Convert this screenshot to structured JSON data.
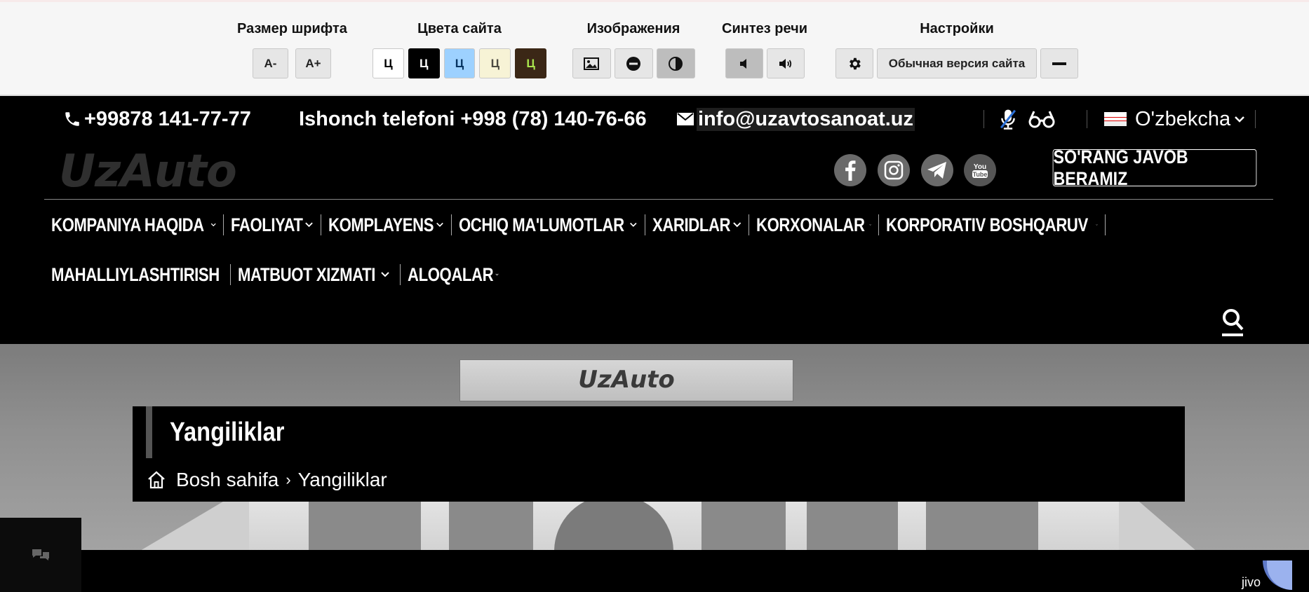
{
  "a11y_panel": {
    "font_size": {
      "title": "Размер шрифта",
      "decrease": "A-",
      "increase": "A+"
    },
    "site_colors": {
      "title": "Цвета сайта",
      "letter": "Ц",
      "swatches": [
        {
          "bg": "#ffffff",
          "fg": "#000000"
        },
        {
          "bg": "#000000",
          "fg": "#ffffff"
        },
        {
          "bg": "#9dd1ff",
          "fg": "#063462"
        },
        {
          "bg": "#f7f3d6",
          "fg": "#4d4b43"
        },
        {
          "bg": "#3b2716",
          "fg": "#a9e44d"
        }
      ]
    },
    "images": {
      "title": "Изображения",
      "icons": [
        "image-icon",
        "images-off-icon",
        "grayscale-icon"
      ]
    },
    "speech": {
      "title": "Синтез речи",
      "icons": [
        "speaker-off-icon",
        "speaker-on-icon"
      ]
    },
    "settings": {
      "title": "Настройки",
      "normal_version": "Обычная версия сайта",
      "icons": [
        "gear-icon",
        "minimize-icon"
      ]
    }
  },
  "contact": {
    "phone": "+99878 141-77-77",
    "trust_phone": "Ishonch telefoni +998 (78) 140-76-66",
    "email": "info@uzavtosanoat.uz",
    "language": "O'zbekcha",
    "icons": [
      "phone-icon",
      "mail-icon",
      "mic-off-icon",
      "glasses-icon",
      "flag-icon",
      "chevron-down-icon"
    ]
  },
  "header": {
    "logo": "UzAuto",
    "social": [
      "facebook-icon",
      "instagram-icon",
      "telegram-icon",
      "youtube-icon"
    ],
    "ask_button": "SO'RANG JAVOB BERAMIZ"
  },
  "nav": {
    "row1": [
      {
        "label": "KOMPANIYA HAQIDA",
        "dropdown": true
      },
      {
        "label": "FAOLIYAT",
        "dropdown": true
      },
      {
        "label": "KOMPLAYENS",
        "dropdown": true
      },
      {
        "label": "OCHIQ MA'LUMOTLAR",
        "dropdown": true
      },
      {
        "label": "XARIDLAR",
        "dropdown": true
      },
      {
        "label": "KORXONALAR",
        "dropdown": true
      },
      {
        "label": "KORPORATIV BOSHQARUV",
        "dropdown": true
      }
    ],
    "row2": [
      {
        "label": "MAHALLIYLASHTIRISH",
        "dropdown": false
      },
      {
        "label": "MATBUOT XIZMATI",
        "dropdown": true
      },
      {
        "label": "ALOQALAR",
        "dropdown": true
      }
    ]
  },
  "hero": {
    "building_logo": "UzAuto",
    "page_title": "Yangiliklar",
    "breadcrumb": {
      "home": "Bosh sahifa",
      "current": "Yangiliklar"
    }
  },
  "widgets": {
    "chat": "chat-icon",
    "jivo": "jivo"
  }
}
